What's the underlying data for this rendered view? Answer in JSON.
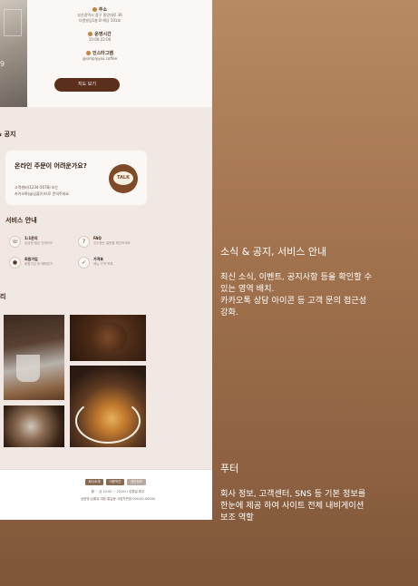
{
  "mockup": {
    "left_photo_number": "9",
    "address": {
      "label": "주소",
      "lines": [
        "부산광역시 중구 중앙대로 36",
        "다원빌딩1층 B 해당 101호"
      ]
    },
    "hours": {
      "label": "운영시간",
      "value": "10:00-22:00"
    },
    "instagram": {
      "label": "인스타그램",
      "value": "@simplyyou.coffee"
    },
    "map_button": "지도 보기",
    "news_title": "& 공지",
    "kakao": {
      "heading": "온라인 주문이 어려운가요?",
      "body_lines": [
        "고객센터(1234-5678) 또는",
        "카카오톡(@심플유)으로 문의주세요."
      ],
      "talk_label": "TALK"
    },
    "service_title": "서비스 안내",
    "services": [
      {
        "icon": "headset-icon",
        "title": "1:1문의",
        "sub": "궁금한 점은 언제라도"
      },
      {
        "icon": "faq-icon",
        "title": "FAQ",
        "sub": "자주묻는 질문을 확인하세요"
      },
      {
        "icon": "user-icon",
        "title": "회원가입",
        "sub": "회원가입 후 혜택받기"
      },
      {
        "icon": "checklist-icon",
        "title": "가격표",
        "sub": "메뉴 가격 목록"
      }
    ],
    "gallery_title": "리",
    "footer": {
      "buttons": [
        "회사소개",
        "이용약관",
        "개인정보"
      ],
      "line1": "월 ~ 금 10:00 ~ 22:00 / 공휴일 휴무",
      "line2": "상호명:심플유 대표:홍길동 사업자번호:000-00-00000"
    }
  },
  "descriptions": [
    {
      "title": "소식 & 공지, 서비스 안내",
      "lines": [
        "최신 소식, 이벤트, 공지사항 등을 확인할 수",
        "있는 영역 배치.",
        "카카오톡 상담 아이콘 등 고객 문의 접근성",
        "강화."
      ]
    },
    {
      "title": "푸터",
      "lines": [
        "회사 정보, 고객센터, SNS 등 기본 정보를",
        "한눈에 제공 하여 사이트 전체 내비게이션",
        "보조 역할"
      ]
    }
  ],
  "colors": {
    "accent": "#5b2f1c",
    "panel_top": "#b88a63",
    "panel_bottom": "#7f5638",
    "page_bg": "#f1e7e3"
  }
}
